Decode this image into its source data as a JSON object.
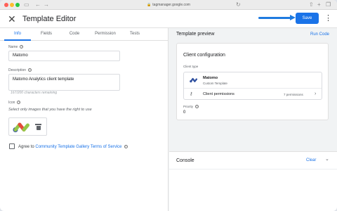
{
  "browser": {
    "url": "tagmanager.google.com",
    "lock_glyph": "🔒",
    "traffic_colors": [
      "#ff5f57",
      "#febc2e",
      "#28c840"
    ],
    "back_glyph": "←",
    "forward_glyph": "→",
    "refresh_glyph": "↻",
    "share_glyph": "⇧",
    "newtab_glyph": "+",
    "tabs_glyph": "❐"
  },
  "header": {
    "close_glyph": "✕",
    "title": "Template Editor",
    "save_label": "Save",
    "more_glyph": "⋮"
  },
  "tabs": [
    {
      "label": "Info"
    },
    {
      "label": "Fields"
    },
    {
      "label": "Code"
    },
    {
      "label": "Permission"
    },
    {
      "label": "Tests"
    }
  ],
  "info": {
    "name_label": "Name",
    "name_value": "Matomo",
    "description_label": "Description",
    "description_value": "Matomo Analytics client template",
    "char_count": "167/200 characters remaining",
    "icon_label": "Icon",
    "icon_note": "Select only images that you have the right to use",
    "agree_prefix": "Agree to ",
    "agree_link": "Community Template Gallery Terms of Service"
  },
  "preview": {
    "title": "Template preview",
    "run_code": "Run Code",
    "config_title": "Client configuration",
    "client_type_label": "Client type",
    "client_name": "Matomo",
    "client_sub": "Custom Template",
    "permissions_label": "Client permissions",
    "permissions_count": "7 permissions",
    "chevron_right": "›",
    "key_glyph": "⚷",
    "priority_label": "Priority",
    "priority_value": "0"
  },
  "console": {
    "title": "Console",
    "clear": "Clear",
    "chevron": "⌄"
  },
  "colors": {
    "accent": "#1a73e8",
    "logo_blue": "#3152a0",
    "logo_green": "#95c748",
    "logo_red": "#e44c3a"
  }
}
